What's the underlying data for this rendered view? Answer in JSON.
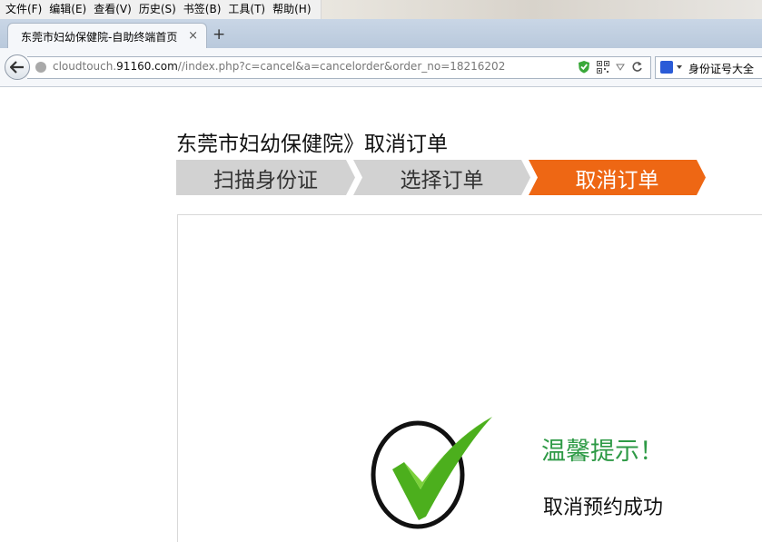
{
  "browser": {
    "menu": [
      "文件(F)",
      "编辑(E)",
      "查看(V)",
      "历史(S)",
      "书签(B)",
      "工具(T)",
      "帮助(H)"
    ],
    "tab": {
      "title": "东莞市妇幼保健院-自助终端首页",
      "close": "×",
      "new_tab": "+"
    },
    "url": {
      "prefix": "cloudtouch.",
      "host": "91160.com",
      "path": "//index.php?c=cancel&a=cancelorder&order_no=18216202"
    },
    "search": {
      "value": "身份证号大全"
    }
  },
  "page": {
    "title": "东莞市妇幼保健院》取消订单",
    "steps": [
      {
        "label": "扫描身份证",
        "state": "done"
      },
      {
        "label": "选择订单",
        "state": "done"
      },
      {
        "label": "取消订单",
        "state": "active"
      }
    ],
    "tip_title": "温馨提示！",
    "tip_message": "取消预约成功"
  },
  "colors": {
    "active_step": "#ee6714",
    "inactive_step": "#d2d2d2",
    "tip_green": "#2e9a46",
    "check_green": "#4caf1d"
  },
  "icons": [
    "back-arrow-icon",
    "globe-icon",
    "shield-icon",
    "qr-code-icon",
    "dropdown-icon",
    "reload-icon",
    "baidu-icon",
    "checkmark-icon"
  ]
}
